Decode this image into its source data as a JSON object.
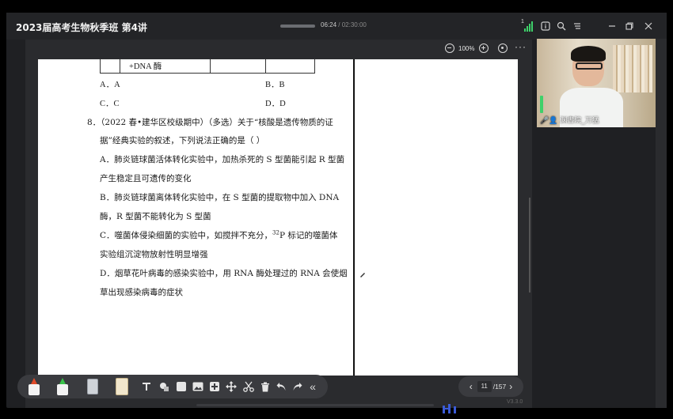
{
  "window": {
    "title": "2023届高考生物秋季班 第4讲",
    "time_current": "06:24",
    "time_sep": " / ",
    "time_total": "02:30:00",
    "signal_level": "1"
  },
  "titlebar_icons": [
    "info-icon",
    "search-zoom-icon",
    "menu-icon",
    "minimize-icon",
    "restore-icon",
    "close-icon"
  ],
  "doc_toolbar": {
    "zoom": "100%"
  },
  "page": {
    "table_cell": "+DNA 酶",
    "opt_a": "A．A",
    "opt_b": "B．B",
    "opt_c": "C．C",
    "opt_d": "D．D",
    "q8_line1": "8．（2022 春•建华区校级期中）（多选）关于“核酸是遗传物质的证",
    "q8_line2": "据”经典实验的叙述，下列说法正确的是（      ）",
    "q8_a1": "A．肺炎链球菌活体转化实验中，加热杀死的 S 型菌能引起 R 型菌",
    "q8_a2": "产生稳定且可遗传的变化",
    "q8_b1": "B．肺炎链球菌离体转化实验中，在 S 型菌的提取物中加入 DNA",
    "q8_b2": "酶，R 型菌不能转化为 S 型菌",
    "q8_c1_pre": "C．噬菌体侵染细菌的实验中，如搅拌不充分，",
    "q8_c1_sup": "32",
    "q8_c1_post": "P 标记的噬菌体",
    "q8_c2": "实验组沉淀物放射性明显增强",
    "q8_d1": "D．烟草花叶病毒的感染实验中，用 RNA 酶处理过的 RNA 会使烟",
    "q8_d2": "草出现感染病毒的症状"
  },
  "pager": {
    "current": "11",
    "total": "/157"
  },
  "webcam": {
    "caption": "🎤👤 渊書院_万猛"
  },
  "footer": {
    "version": "V3.3.0"
  },
  "colors": {
    "app_bg": "#1f2023",
    "accent_green": "#3ed16a"
  }
}
